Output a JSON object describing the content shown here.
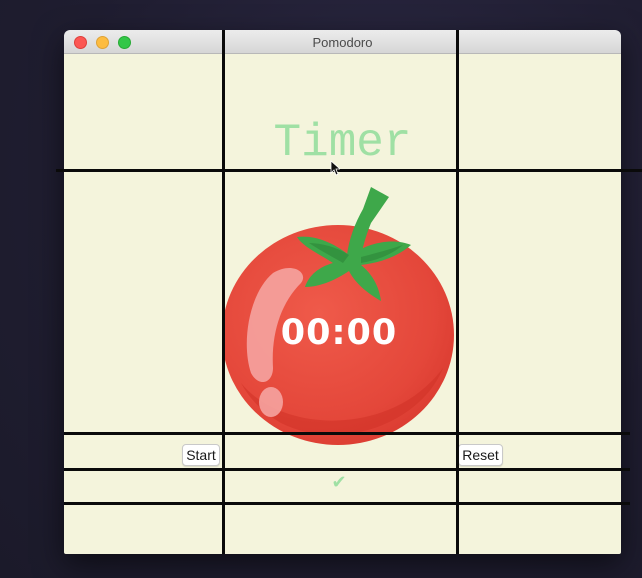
{
  "window": {
    "title": "Pomodoro"
  },
  "app": {
    "heading": "Timer",
    "countdown": "00:00",
    "start_label": "Start",
    "reset_label": "Reset",
    "checkmarks": "✔"
  },
  "colors": {
    "background": "#f4f4dc",
    "accent_green": "#9fe0a4",
    "tomato_red": "#e84a3b",
    "leaf_green": "#3ea84a"
  },
  "icons": {
    "tomato": "tomato-icon",
    "check": "check-icon",
    "cursor": "mouse-pointer-icon"
  }
}
